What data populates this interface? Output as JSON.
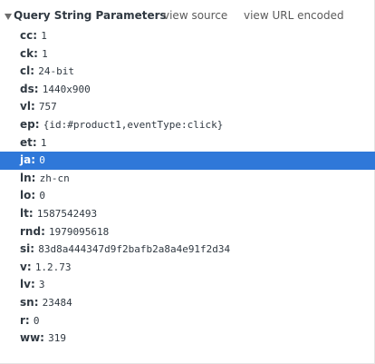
{
  "section": {
    "title": "Query String Parameters",
    "view_source_label": "view source",
    "view_encoded_label": "view URL encoded"
  },
  "params": [
    {
      "name": "cc",
      "value": "1"
    },
    {
      "name": "ck",
      "value": "1"
    },
    {
      "name": "cl",
      "value": "24-bit"
    },
    {
      "name": "ds",
      "value": "1440x900"
    },
    {
      "name": "vl",
      "value": "757"
    },
    {
      "name": "ep",
      "value": "{id:#product1,eventType:click}"
    },
    {
      "name": "et",
      "value": "1"
    },
    {
      "name": "ja",
      "value": "0"
    },
    {
      "name": "ln",
      "value": "zh-cn"
    },
    {
      "name": "lo",
      "value": "0"
    },
    {
      "name": "lt",
      "value": "1587542493"
    },
    {
      "name": "rnd",
      "value": "1979095618"
    },
    {
      "name": "si",
      "value": "83d8a444347d9f2bafb2a8a4e91f2d34"
    },
    {
      "name": "v",
      "value": "1.2.73"
    },
    {
      "name": "lv",
      "value": "3"
    },
    {
      "name": "sn",
      "value": "23484"
    },
    {
      "name": "r",
      "value": "0"
    },
    {
      "name": "ww",
      "value": "319"
    }
  ],
  "selected_param": "ja",
  "colors": {
    "selection": "#2f78d9",
    "text": "#303942",
    "link": "#5a5a5a"
  }
}
